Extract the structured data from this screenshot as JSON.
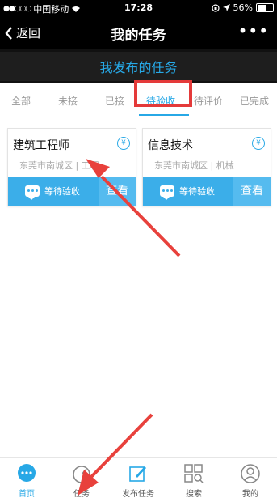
{
  "status_bar": {
    "carrier": "中国移动",
    "time": "17:28",
    "battery": "56%"
  },
  "nav": {
    "back_label": "返回",
    "title": "我的任务",
    "more": "•••"
  },
  "section_title": "我发布的任务",
  "tabs": [
    {
      "label": "全部"
    },
    {
      "label": "未接"
    },
    {
      "label": "已接"
    },
    {
      "label": "待验收"
    },
    {
      "label": "待评价"
    },
    {
      "label": "已完成"
    }
  ],
  "cards": [
    {
      "title": "建筑工程师",
      "location": "东莞市南城区 | 工程",
      "status_label": "等待验收",
      "view_label": "查看"
    },
    {
      "title": "信息技术",
      "location": "东莞市南城区 | 机械",
      "status_label": "等待验收",
      "view_label": "查看"
    }
  ],
  "tabbar": [
    {
      "label": "首页",
      "icon": "chat-bubble-icon"
    },
    {
      "label": "任务",
      "icon": "gauge-icon"
    },
    {
      "label": "发布任务",
      "icon": "edit-icon"
    },
    {
      "label": "搜索",
      "icon": "grid-search-icon"
    },
    {
      "label": "我的",
      "icon": "user-icon"
    }
  ],
  "colors": {
    "accent": "#27a8e6",
    "highlight": "#e43a3a"
  }
}
